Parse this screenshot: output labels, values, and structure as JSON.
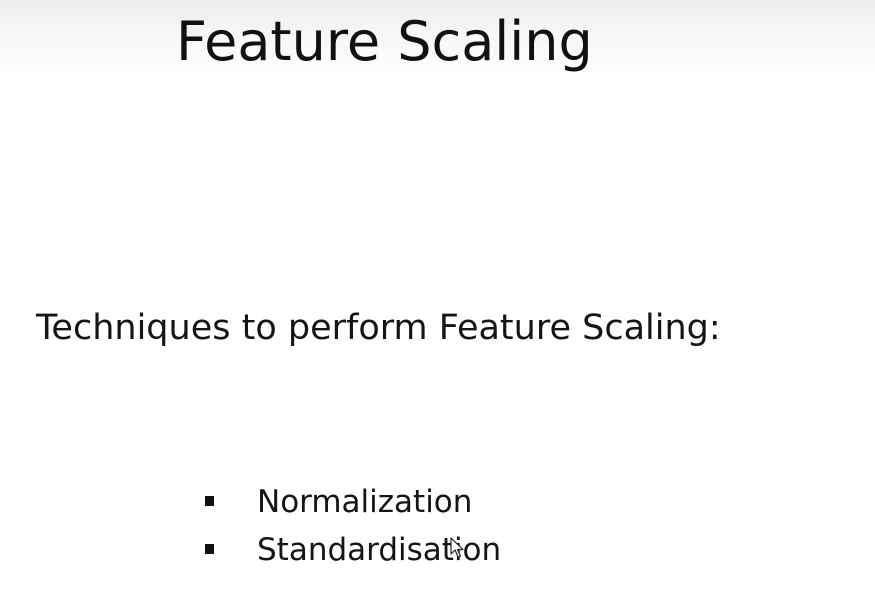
{
  "slide": {
    "title": "Feature Scaling",
    "subtitle": "Techniques to perform Feature Scaling:",
    "bullets": [
      {
        "label": "Normalization"
      },
      {
        "label": "Standardisation"
      }
    ]
  },
  "colors": {
    "background": "#ffffff",
    "text": "#151515",
    "header_fade": "#ececec"
  },
  "icons": {
    "cursor": "mouse-pointer-icon",
    "bullet": "square-bullet-icon"
  }
}
